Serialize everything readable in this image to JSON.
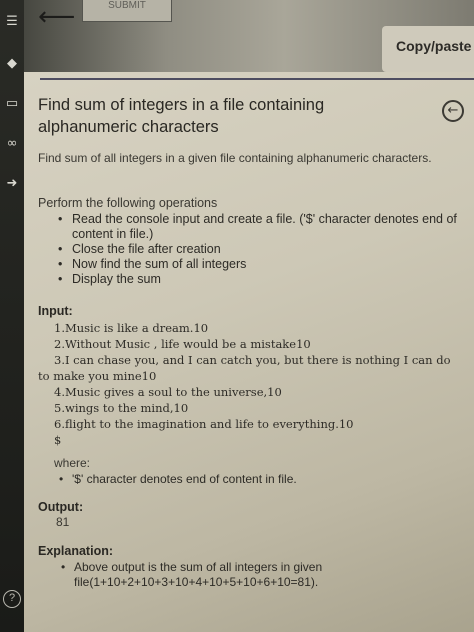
{
  "toolbar": {
    "submit_label": "SUBMIT",
    "copy_paste_label": "Copy/paste"
  },
  "problem": {
    "title": "Find sum of integers in a file containing alphanumeric characters",
    "description": "Find sum of all integers in a given file containing alphanumeric characters.",
    "operations_intro": "Perform the following operations",
    "operations": [
      "Read the console input and create a file. ('$' character denotes end of content in file.)",
      "Close the file after creation",
      "Now find the sum of all integers",
      "Display the sum"
    ],
    "input_label": "Input:",
    "input_lines": [
      "1.Music is like a dream.10",
      "2.Without Music , life would be a mistake10",
      "3.I can chase you, and I can catch you, but there is nothing I can do",
      "to make you mine10",
      "4.Music gives a soul to the universe,10",
      "5.wings to the mind,10",
      "6.flight to the imagination and life to everything.10",
      "$"
    ],
    "where_label": "where:",
    "where_items": [
      "'$' character denotes end of content in file."
    ],
    "output_label": "Output:",
    "output_value": "81",
    "explanation_label": "Explanation:",
    "explanation_items": [
      "Above output is the sum of all integers in given file(1+10+2+10+3+10+4+10+5+10+6+10=81)."
    ]
  },
  "icons": {
    "back": "arrow-left-icon",
    "help": "?"
  }
}
